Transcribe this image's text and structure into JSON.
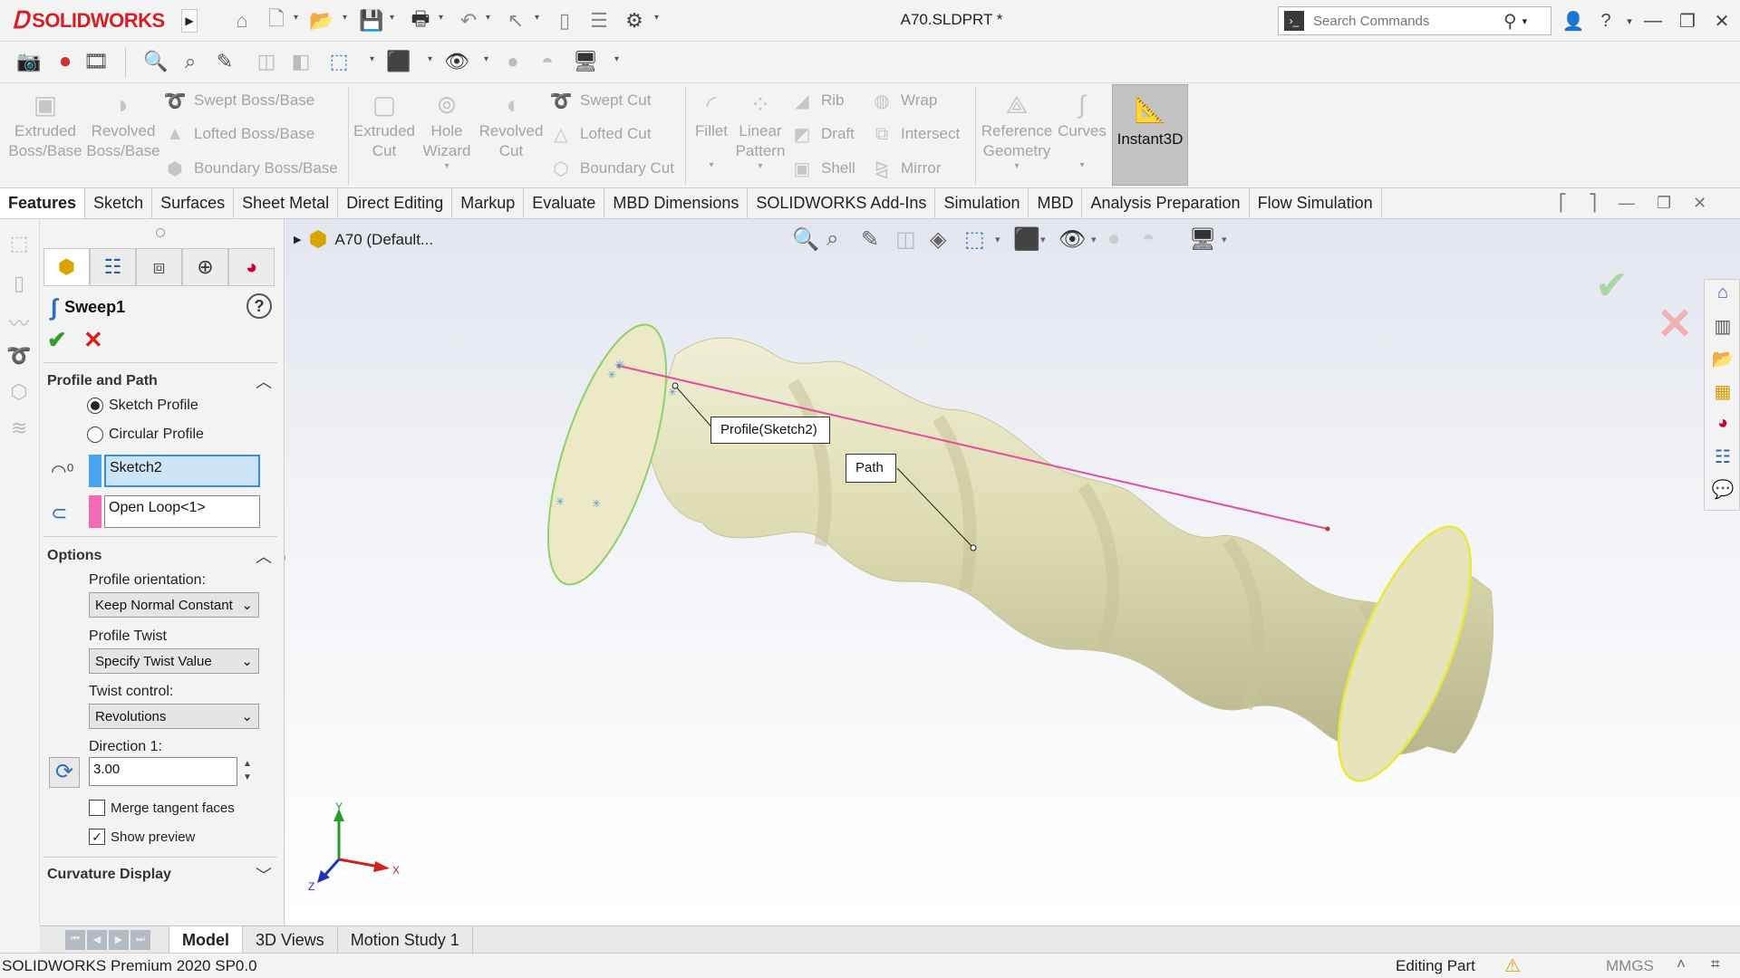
{
  "app": {
    "brand": "SOLIDWORKS",
    "document_title": "A70.SLDPRT *"
  },
  "search": {
    "placeholder": "Search Commands"
  },
  "ribbon": {
    "extruded_boss": "Extruded\nBoss/Base",
    "revolved_boss": "Revolved\nBoss/Base",
    "swept_boss": "Swept Boss/Base",
    "lofted_boss": "Lofted Boss/Base",
    "boundary_boss": "Boundary Boss/Base",
    "extruded_cut": "Extruded\nCut",
    "hole_wizard": "Hole\nWizard",
    "revolved_cut": "Revolved\nCut",
    "swept_cut": "Swept Cut",
    "lofted_cut": "Lofted Cut",
    "boundary_cut": "Boundary Cut",
    "fillet": "Fillet",
    "linear_pattern": "Linear\nPattern",
    "rib": "Rib",
    "draft": "Draft",
    "shell": "Shell",
    "wrap": "Wrap",
    "intersect": "Intersect",
    "mirror": "Mirror",
    "reference_geometry": "Reference\nGeometry",
    "curves": "Curves",
    "instant3d": "Instant3D"
  },
  "tabs": [
    "Features",
    "Sketch",
    "Surfaces",
    "Sheet Metal",
    "Direct Editing",
    "Markup",
    "Evaluate",
    "MBD Dimensions",
    "SOLIDWORKS Add-Ins",
    "Simulation",
    "MBD",
    "Analysis Preparation",
    "Flow Simulation"
  ],
  "property_manager": {
    "feature_name": "Sweep1",
    "profile_path": {
      "header": "Profile and Path",
      "sketch_profile": "Sketch Profile",
      "circular_profile": "Circular Profile",
      "profile_value": "Sketch2",
      "path_value": "Open Loop<1>"
    },
    "options": {
      "header": "Options",
      "orientation_label": "Profile orientation:",
      "orientation_value": "Keep Normal Constant",
      "twist_label": "Profile Twist",
      "twist_value": "Specify Twist Value",
      "twist_control_label": "Twist control:",
      "twist_control_value": "Revolutions",
      "direction_label": "Direction 1:",
      "direction_value": "3.00",
      "merge_tangent": "Merge tangent faces",
      "show_preview": "Show preview"
    },
    "curvature_header": "Curvature Display"
  },
  "viewport": {
    "tree_node": "A70  (Default...",
    "callout_profile": "Profile(Sketch2)",
    "callout_path": "Path",
    "triad_x": "X",
    "triad_y": "Y",
    "triad_z": "Z",
    "body_color": "#e4e2bd"
  },
  "bottom_tabs": [
    "Model",
    "3D Views",
    "Motion Study 1"
  ],
  "status": {
    "product": "SOLIDWORKS Premium 2020 SP0.0",
    "mode": "Editing Part",
    "units": "MMGS"
  }
}
